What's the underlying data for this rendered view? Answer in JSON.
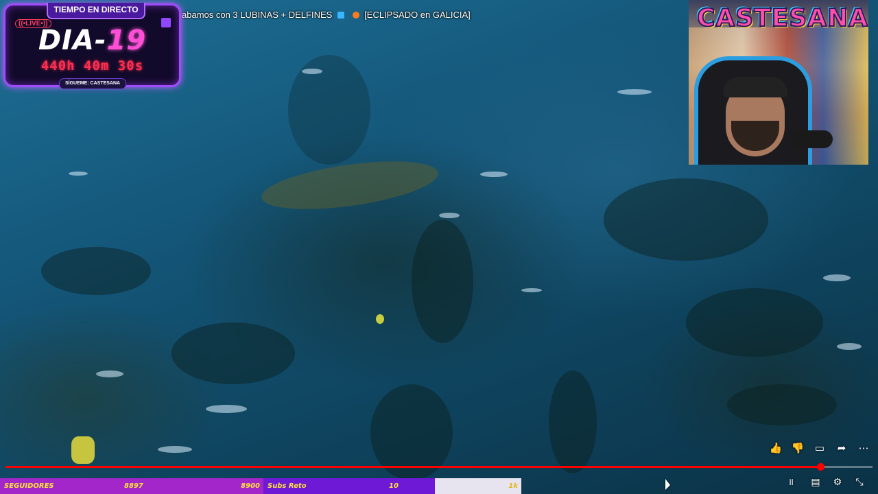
{
  "stream": {
    "title": "abamos con 3 LUBINAS + DELFINES",
    "title_tag": "[ECLIPSADO en GALICIA]"
  },
  "overlay": {
    "header": "TIEMPO EN DIRECTO",
    "live": "((•LIVE•))",
    "day_prefix": "DIA-",
    "day_number": "19",
    "timer": "440h 40m 30s",
    "follow": "SÍGUEME: CASTESANA",
    "brand": "CASTESANA"
  },
  "ticker": {
    "followers_label": "SEGUIDORES",
    "followers_value": "8897",
    "followers_goal": "8900",
    "subs_label": "Subs Reto",
    "subs_value": "10",
    "subs_goal": "1k"
  },
  "player": {
    "progress": 0.94,
    "actions": [
      "like-icon",
      "dislike-icon",
      "comment-icon",
      "share-icon",
      "more-icon"
    ],
    "controls": [
      "pause-icon",
      "subtitles-icon",
      "settings-icon",
      "exit-fullscreen-icon"
    ]
  },
  "colors": {
    "accent": "#ff0000",
    "overlay_purple": "#a14bff",
    "timer_red": "#ff2e4f"
  }
}
